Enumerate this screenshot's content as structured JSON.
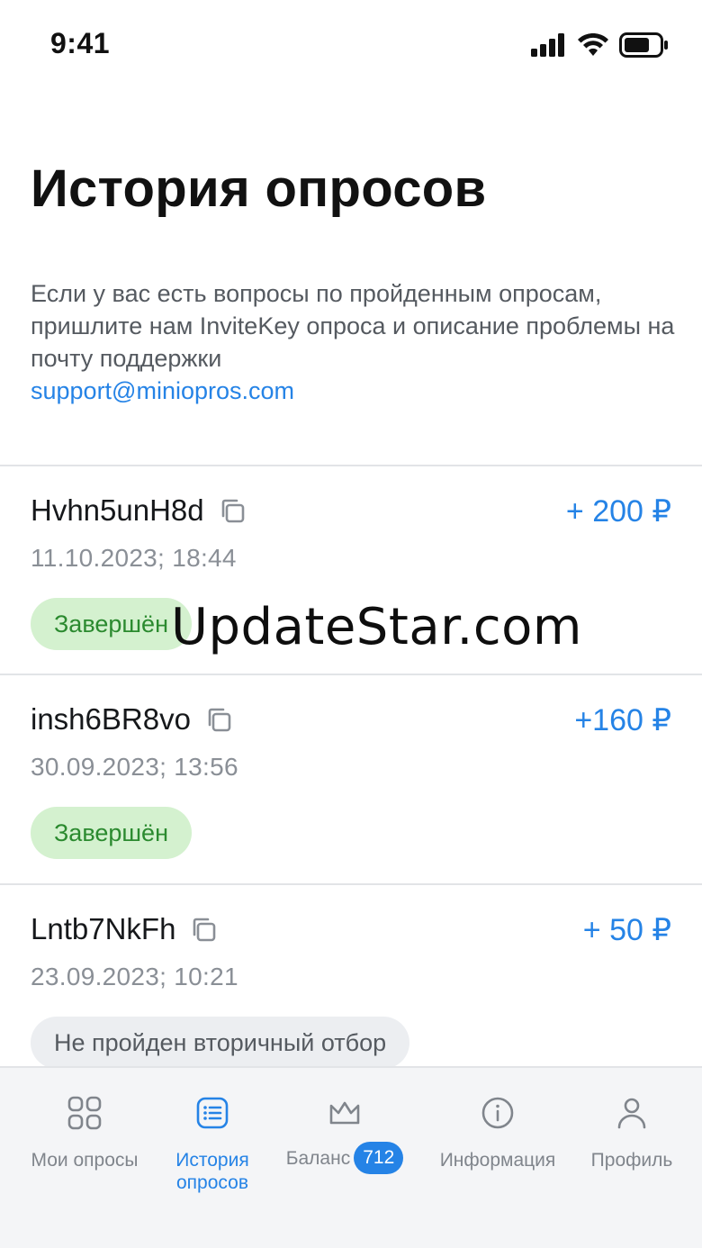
{
  "status_bar": {
    "time": "9:41"
  },
  "header": {
    "title": "История опросов",
    "info_text": "Если у вас есть вопросы по пройденным опросам, пришлите нам InviteKey опроса и описание проблемы на почту поддержки",
    "support_email": "support@miniopros.com"
  },
  "surveys": [
    {
      "key": "Hvhn5unH8d",
      "amount": "+ 200 ₽",
      "datetime": "11.10.2023; 18:44",
      "status": "Завершён"
    },
    {
      "key": "insh6BR8vo",
      "amount": "+160 ₽",
      "datetime": "30.09.2023; 13:56",
      "status": "Завершён"
    },
    {
      "key": "Lntb7NkFh",
      "amount": "+ 50 ₽",
      "datetime": "23.09.2023; 10:21",
      "status": "Не пройден вторичный отбор"
    }
  ],
  "watermark": "UpdateStar.com",
  "bottom_nav": {
    "items": [
      {
        "label": "Мои опросы",
        "icon": "grid-icon"
      },
      {
        "label": "История\nопросов",
        "icon": "list-icon"
      },
      {
        "label": "Баланс",
        "icon": "crown-icon",
        "badge": "712"
      },
      {
        "label": "Информация",
        "icon": "info-icon"
      },
      {
        "label": "Профиль",
        "icon": "profile-icon"
      }
    ]
  },
  "colors": {
    "accent": "#2583e6",
    "success_bg": "#d4f1cf",
    "success_text": "#2b8a2f",
    "neutral_bg": "#eceef1"
  }
}
